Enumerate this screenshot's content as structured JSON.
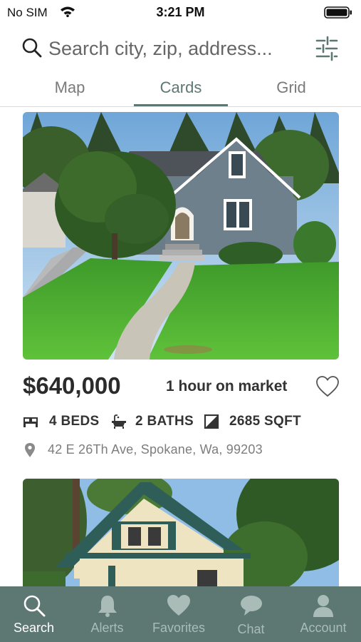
{
  "status_bar": {
    "carrier": "No SIM",
    "time": "3:21 PM"
  },
  "search": {
    "placeholder": "Search city, zip, address..."
  },
  "tabs": [
    {
      "label": "Map",
      "active": false
    },
    {
      "label": "Cards",
      "active": true
    },
    {
      "label": "Grid",
      "active": false
    }
  ],
  "listing": {
    "price": "$640,000",
    "market_time": "1 hour on market",
    "beds": "4 BEDS",
    "baths": "2 BATHS",
    "sqft": "2685 SQFT",
    "address": "42 E 26Th Ave, Spokane, Wa, 99203",
    "favorited": false
  },
  "bottom_nav": [
    {
      "label": "Search",
      "icon": "search-icon",
      "active": true
    },
    {
      "label": "Alerts",
      "icon": "bell-icon",
      "active": false
    },
    {
      "label": "Favorites",
      "icon": "heart-icon",
      "active": false
    },
    {
      "label": "Chat",
      "icon": "chat-bubble-icon",
      "active": false
    },
    {
      "label": "Account",
      "icon": "person-icon",
      "active": false
    }
  ],
  "colors": {
    "accent": "#5d7773",
    "nav_inactive_label": "#a9bcb8",
    "nav_active_label": "#ffffff"
  }
}
